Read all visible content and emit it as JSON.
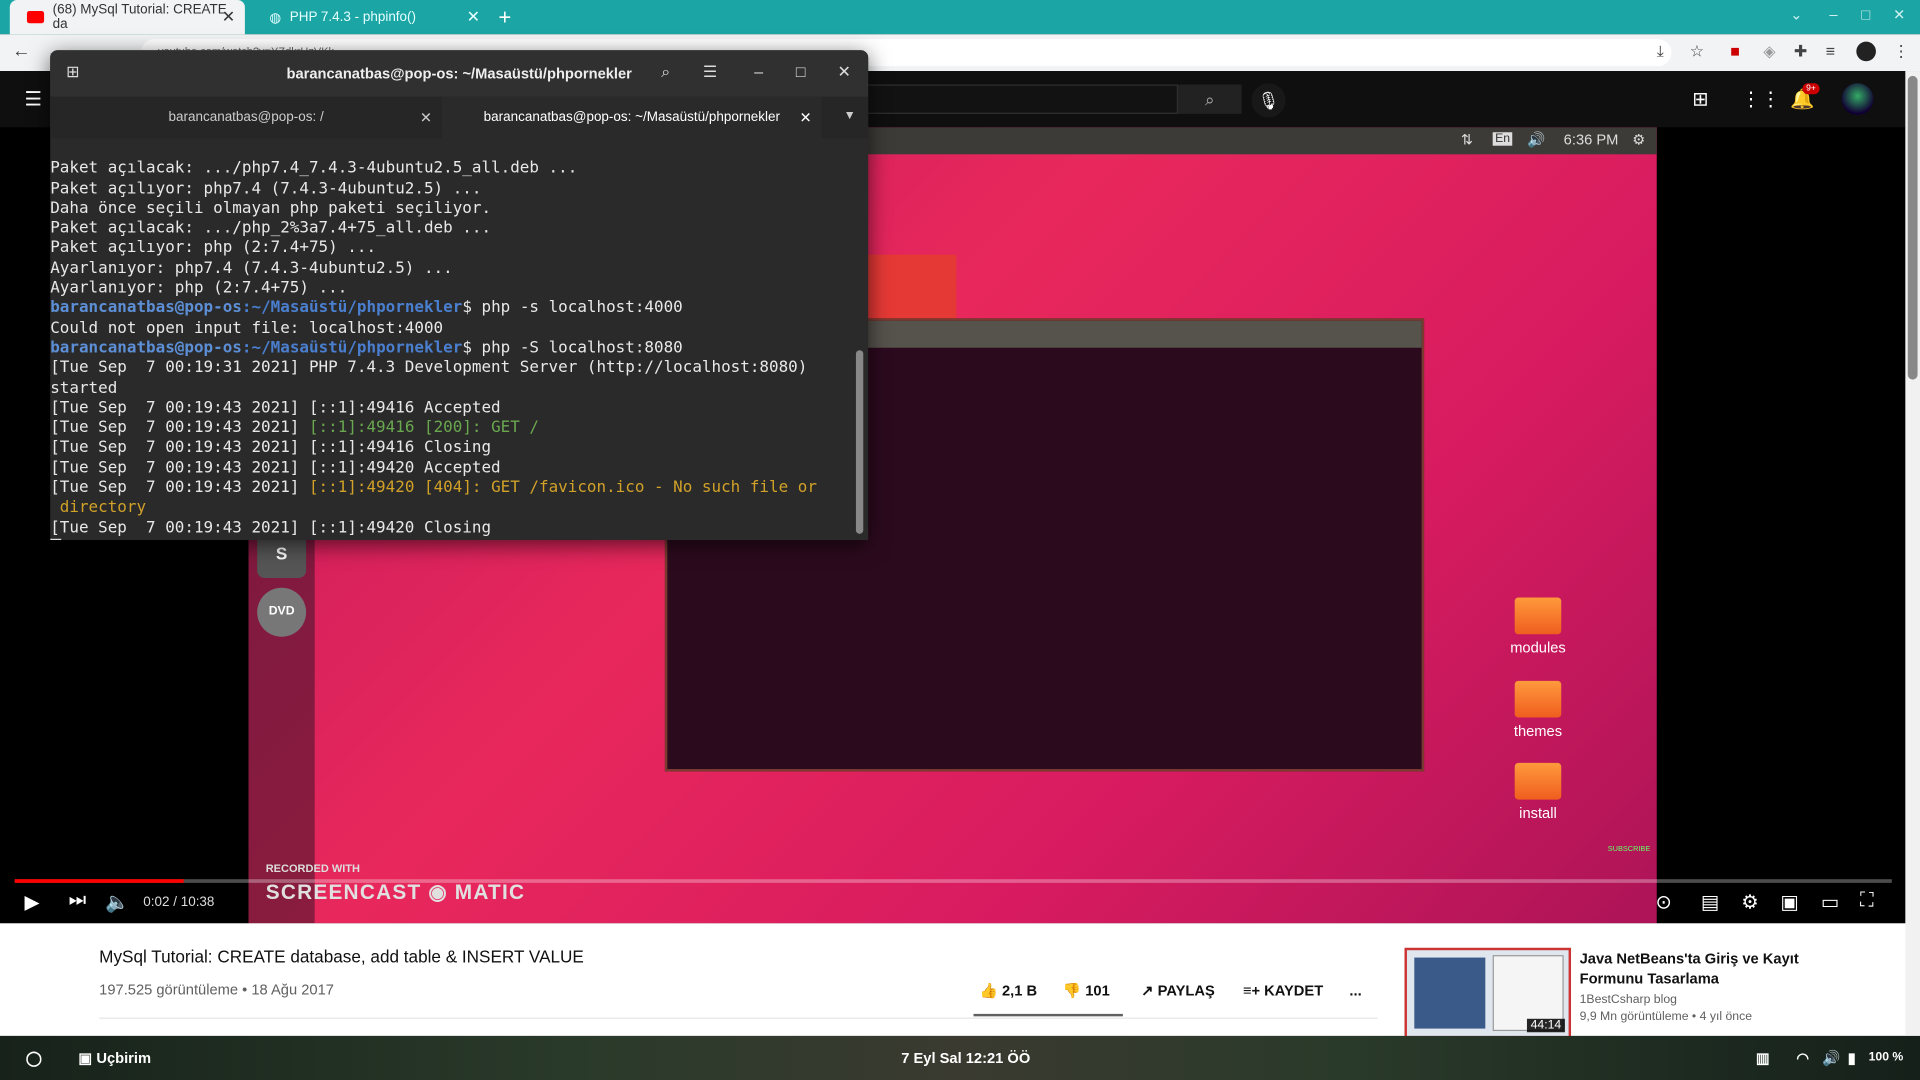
{
  "browser": {
    "tabs": [
      {
        "label": "(68) MySql Tutorial: CREATE da",
        "favicon": "youtube-icon"
      },
      {
        "label": "PHP 7.4.3 - phpinfo()",
        "favicon": "globe-icon"
      }
    ],
    "new_tab": "+",
    "url": "youtube.com/watch?v=YZdkrHzVKk"
  },
  "youtube": {
    "notifications_count": "9+"
  },
  "terminal": {
    "title": "barancanatbas@pop-os: ~/Masaüstü/phpornekler",
    "tabs": [
      {
        "label": "barancanatbas@pop-os: /"
      },
      {
        "label": "barancanatbas@pop-os: ~/Masaüstü/phpornekler"
      }
    ],
    "lines": [
      "Paket açılacak: .../php7.4_7.4.3-4ubuntu2.5_all.deb ...",
      "Paket açılıyor: php7.4 (7.4.3-4ubuntu2.5) ...",
      "Daha önce seçili olmayan php paketi seçiliyor.",
      "Paket açılacak: .../php_2%3a7.4+75_all.deb ...",
      "Paket açılıyor: php (2:7.4+75) ...",
      "Ayarlanıyor: php7.4 (7.4.3-4ubuntu2.5) ...",
      "Ayarlanıyor: php (2:7.4+75) ..."
    ],
    "prompt_user": "barancanatbas@pop-os",
    "prompt_path": ":~/Masaüstü/phpornekler",
    "cmd1": "$ php -s localhost:4000",
    "out1": "Could not open input file: localhost:4000",
    "cmd2": "$ php -S localhost:8080",
    "log": [
      {
        "plain": "[Tue Sep  7 00:19:31 2021] PHP 7.4.3 Development Server (http://localhost:8080)",
        "color": ""
      },
      {
        "plain": "started",
        "color": ""
      },
      {
        "plain": "[Tue Sep  7 00:19:43 2021] [::1]:49416 Accepted",
        "color": ""
      },
      {
        "plain": "[Tue Sep  7 00:19:43 2021] ",
        "colored": "[::1]:49416 [200]: GET /",
        "color": "green"
      },
      {
        "plain": "[Tue Sep  7 00:19:43 2021] [::1]:49416 Closing",
        "color": ""
      },
      {
        "plain": "[Tue Sep  7 00:19:43 2021] [::1]:49420 Accepted",
        "color": ""
      },
      {
        "plain": "[Tue Sep  7 00:19:43 2021] ",
        "colored": "[::1]:49420 [404]: GET /favicon.ico - No such file or",
        "color": "yellow"
      },
      {
        "plain": "",
        "colored": " directory",
        "color": "yellow"
      },
      {
        "plain": "[Tue Sep  7 00:19:43 2021] [::1]:49420 Closing",
        "color": ""
      }
    ]
  },
  "video_frame": {
    "clock": "6:36 PM",
    "lang": "En",
    "desktop_icons": [
      "modules",
      "themes",
      "install"
    ],
    "watermark_top": "RECORDED WITH",
    "watermark_brand": "SCREENCAST ◉ MATIC",
    "subscribe": "SUBSCRIBE"
  },
  "player": {
    "time": "0:02 / 10:38",
    "progress": 0.003
  },
  "video_info": {
    "title": "MySql Tutorial: CREATE database, add table & INSERT VALUE",
    "meta": "197.525 görüntüleme • 18 Ağu 2017",
    "likes": "2,1 B",
    "dislikes": "101",
    "share": "PAYLAŞ",
    "save": "KAYDET",
    "more": "..."
  },
  "recommendation": {
    "title": "Java NetBeans'ta Giriş ve Kayıt Formunu Tasarlama",
    "channel": "1BestCsharp blog",
    "stats": "9,9 Mn görüntüleme • 4 yıl önce",
    "duration": "44:14"
  },
  "os_panel": {
    "app": "Uçbirim",
    "datetime": "7 Eyl Sal  12:21 ÖÖ",
    "battery": "100 %"
  }
}
